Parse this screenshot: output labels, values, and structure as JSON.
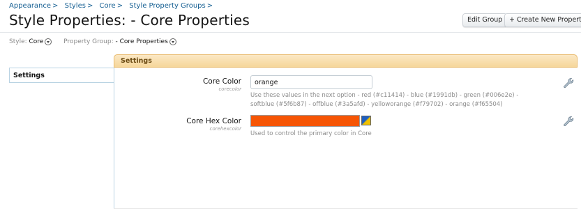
{
  "breadcrumb": {
    "items": [
      {
        "label": "Appearance"
      },
      {
        "label": "Styles"
      },
      {
        "label": "Core"
      },
      {
        "label": "Style Property Groups"
      }
    ],
    "separator": ">"
  },
  "page": {
    "title": "Style Properties: - Core Properties",
    "buttons": {
      "edit_group": "Edit Group",
      "create_new": "+ Create New Property"
    }
  },
  "filters": {
    "style_label": "Style:",
    "style_value": "Core",
    "group_label": "Property Group:",
    "group_value": "- Core Properties"
  },
  "sidebar": {
    "tabs": [
      {
        "label": "Settings"
      }
    ]
  },
  "panel": {
    "header": "Settings",
    "properties": [
      {
        "label": "Core Color",
        "key": "corecolor",
        "value": "orange",
        "hint": "Use these values in the next option - red (#c11414) - blue (#1991db) - green (#006e2e) - softblue (#5f6b87) - offblue (#3a5afd) - yelloworange (#f79702) - orange (#f65504)"
      },
      {
        "label": "Core Hex Color",
        "key": "corehexcolor",
        "color": "#f65504",
        "hint": "Used to control the primary color in Core"
      }
    ]
  },
  "colors": {
    "link": "#176093",
    "header_bg": "#f6d79a",
    "accent": "#f65504"
  },
  "icons": {
    "dropdown": "chevron-down-circle-icon",
    "color_picker": "color-picker-icon",
    "edit": "wrench-icon"
  }
}
